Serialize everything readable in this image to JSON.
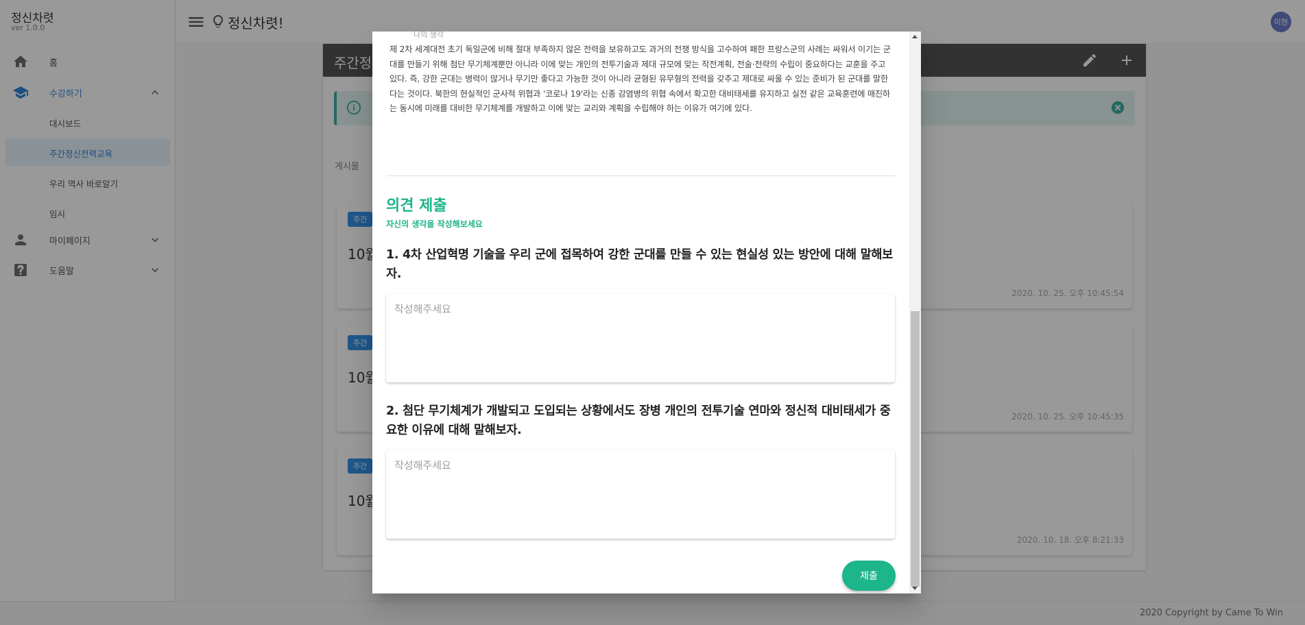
{
  "app": {
    "name": "정신차렷",
    "version": "ver 1.0.0",
    "brand": "정신차렷!",
    "avatar": "이현"
  },
  "sidebar": {
    "items": [
      {
        "label": "홈",
        "icon": "home-icon"
      },
      {
        "label": "수강하기",
        "icon": "school-icon"
      },
      {
        "label": "마이페이지",
        "icon": "person-icon"
      },
      {
        "label": "도움말",
        "icon": "help-icon"
      }
    ],
    "subitems": [
      {
        "label": "대시보드"
      },
      {
        "label": "주간정신전력교육",
        "selected": true
      },
      {
        "label": "우리 역사 바로알기"
      },
      {
        "label": "임시"
      }
    ]
  },
  "main": {
    "header_title": "주간정",
    "board_label": "게시물",
    "posts": [
      {
        "chip": "주간",
        "title": "10월",
        "date": "2020. 10. 25. 오후 10:45:54"
      },
      {
        "chip": "주간",
        "title": "10월",
        "date": "2020. 10. 25. 오후 10:45:35"
      },
      {
        "chip": "주간",
        "title": "10월",
        "date": "2020. 10. 18. 오후 8:21:33"
      }
    ]
  },
  "footer": {
    "copyright": "2020 Copyright by Came To Win"
  },
  "dialog": {
    "cutoff_text": "나의 생각",
    "article": "제 2차 세계대전 초기 독일군에 비해 절대 부족하지 않은 전력을 보유하고도 과거의 전쟁 방식을 고수하여 패한 프랑스군의 사례는 싸워서 이기는 군대를 만들기 위해 첨단 무기체계뿐만 아니라 이에 맞는 개인의 전투기술과 제대 규모에 맞는 작전계획, 전술·전략의 수립이 중요하다는 교훈을 주고 있다. 즉, 강한 군대는 병력이 많거나 무기만 좋다고 가능한 것이 아니라 균형된 유무형의 전력을 갖추고 제대로 싸울 수 있는 준비가 된 군대를 말한다는 것이다. 북한의 현실적인 군사적 위협과 '코로나 19'라는 신종 감염병의 위협 속에서 확고한 대비태세를 유지하고 실전 같은 교육훈련에 매진하는 동시에 미래를 대비한 무기체계를 개발하고 이에 맞는 교리와 계획을 수립해야 하는 이유가 여기에 있다.",
    "section_title": "의견 제출",
    "section_sub": "자신의 생각을 작성해보세요",
    "questions": [
      {
        "text": "1. 4차 산업혁명 기술을 우리 군에 접목하여 강한 군대를 만들 수 있는 현실성 있는 방안에 대해 말해보자.",
        "placeholder": "작성해주세요",
        "value": ""
      },
      {
        "text": "2. 첨단 무기체계가 개발되고 도입되는 상황에서도 장병 개인의 전투기술 연마와 정신적 대비태세가 중요한 이유에 대해 말해보자.",
        "placeholder": "작성해주세요",
        "value": ""
      }
    ],
    "submit_label": "제출"
  },
  "colors": {
    "accent": "#1db58a",
    "primary": "#1976d2",
    "overlay": "rgba(33,33,33,0.46)"
  }
}
